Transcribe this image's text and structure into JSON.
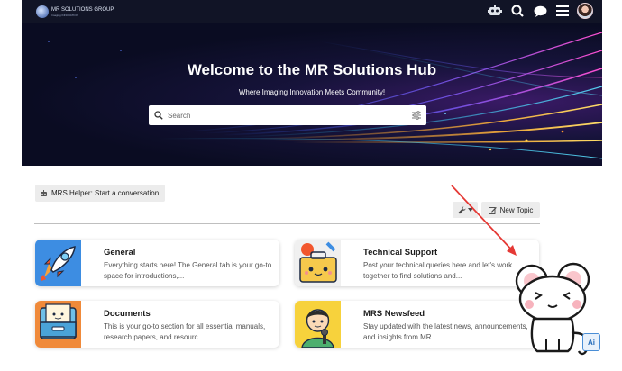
{
  "header": {
    "logo_text": "MR SOLUTIONS GROUP",
    "logo_tagline": "Imaging INNOVATION",
    "icons": [
      "robot-icon",
      "search-icon",
      "chat-icon",
      "menu-icon",
      "user-avatar"
    ]
  },
  "hero": {
    "title": "Welcome to the MR Solutions Hub",
    "subtitle": "Where Imaging Innovation Meets Community!",
    "search_placeholder": "Search"
  },
  "actions": {
    "helper_label": "MRS Helper: Start a conversation",
    "new_topic_label": "New Topic"
  },
  "categories": [
    {
      "title": "General",
      "description": "Everything starts here! The General tab is your go-to space for introductions,...",
      "icon": "rocket-icon",
      "color": "#3d8de2"
    },
    {
      "title": "Technical Support",
      "description": "Post your technical queries here and let's work together to find solutions and...",
      "icon": "toolbox-icon",
      "color": "#f6c94c"
    },
    {
      "title": "Documents",
      "description": "This is your go-to section for all essential manuals, research papers, and resourc...",
      "icon": "filing-cabinet-icon",
      "color": "#f08a3a"
    },
    {
      "title": "MRS Newsfeed",
      "description": "Stay updated with the latest news, announcements, and insights from MR...",
      "icon": "reporter-icon",
      "color": "#f7d23c"
    }
  ],
  "badge": {
    "label": "Ai"
  },
  "colors": {
    "header_bg": "#111426",
    "arrow": "#e53935",
    "button_bg": "#ececec"
  }
}
